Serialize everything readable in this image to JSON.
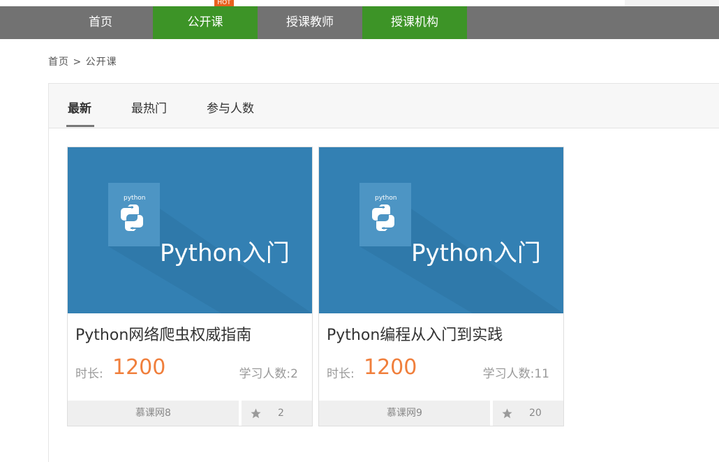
{
  "nav": {
    "items": [
      {
        "label": "首页",
        "active": false
      },
      {
        "label": "公开课",
        "active": true
      },
      {
        "label": "授课教师",
        "active": false
      },
      {
        "label": "授课机构",
        "active": true
      }
    ],
    "hot_badge": "HOT"
  },
  "breadcrumb": {
    "home": "首页",
    "separator": ">",
    "current": "公开课"
  },
  "tabs": [
    {
      "label": "最新",
      "active": true
    },
    {
      "label": "最热门",
      "active": false
    },
    {
      "label": "参与人数",
      "active": false
    }
  ],
  "courses": [
    {
      "image_text": "Python入门",
      "logo_text": "python",
      "title": "Python网络爬虫权威指南",
      "duration_label": "时长:",
      "duration": "1200",
      "students_label": "学习人数:",
      "students": "2",
      "org": "慕课网8",
      "favorites": "2"
    },
    {
      "image_text": "Python入门",
      "logo_text": "python",
      "title": "Python编程从入门到实践",
      "duration_label": "时长:",
      "duration": "1200",
      "students_label": "学习人数:",
      "students": "11",
      "org": "慕课网9",
      "favorites": "20"
    }
  ],
  "colors": {
    "nav_bg": "#727272",
    "nav_active": "#3d9427",
    "accent_orange": "#f07f3c",
    "card_image_bg": "#3380b3"
  },
  "icons": [
    "python-logo-icon",
    "star-icon"
  ]
}
